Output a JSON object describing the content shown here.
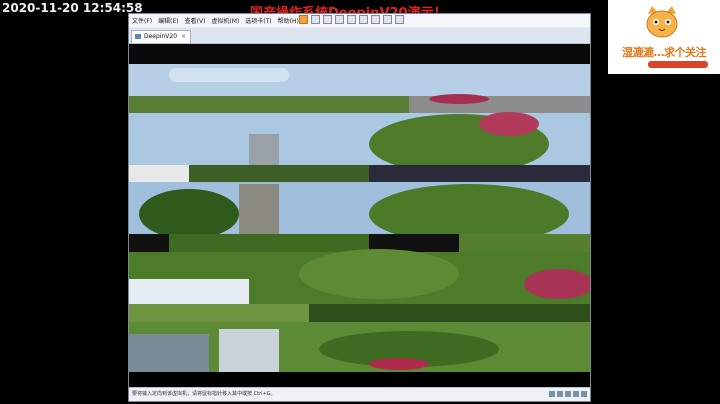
{
  "overlay": {
    "timestamp": "2020-11-20 12:54:58",
    "title": "国产操作系统DeepinV20演示！",
    "logo_slogan": "湿漉漉…求个关注"
  },
  "vm": {
    "menu": [
      "文件(F)",
      "编辑(E)",
      "查看(V)",
      "虚拟机(M)",
      "选项卡(T)",
      "帮助(H)"
    ],
    "tab_label": "DeepinV20",
    "status_text": "要将输入定向到该虚拟机，请将鼠标指针移入其中或按 Ctrl+G。"
  },
  "colors": {
    "sky": "#b9d3ea",
    "foliage": "#4f7a2c",
    "flowers": "#b23a5a",
    "title_red": "#e8201c"
  }
}
